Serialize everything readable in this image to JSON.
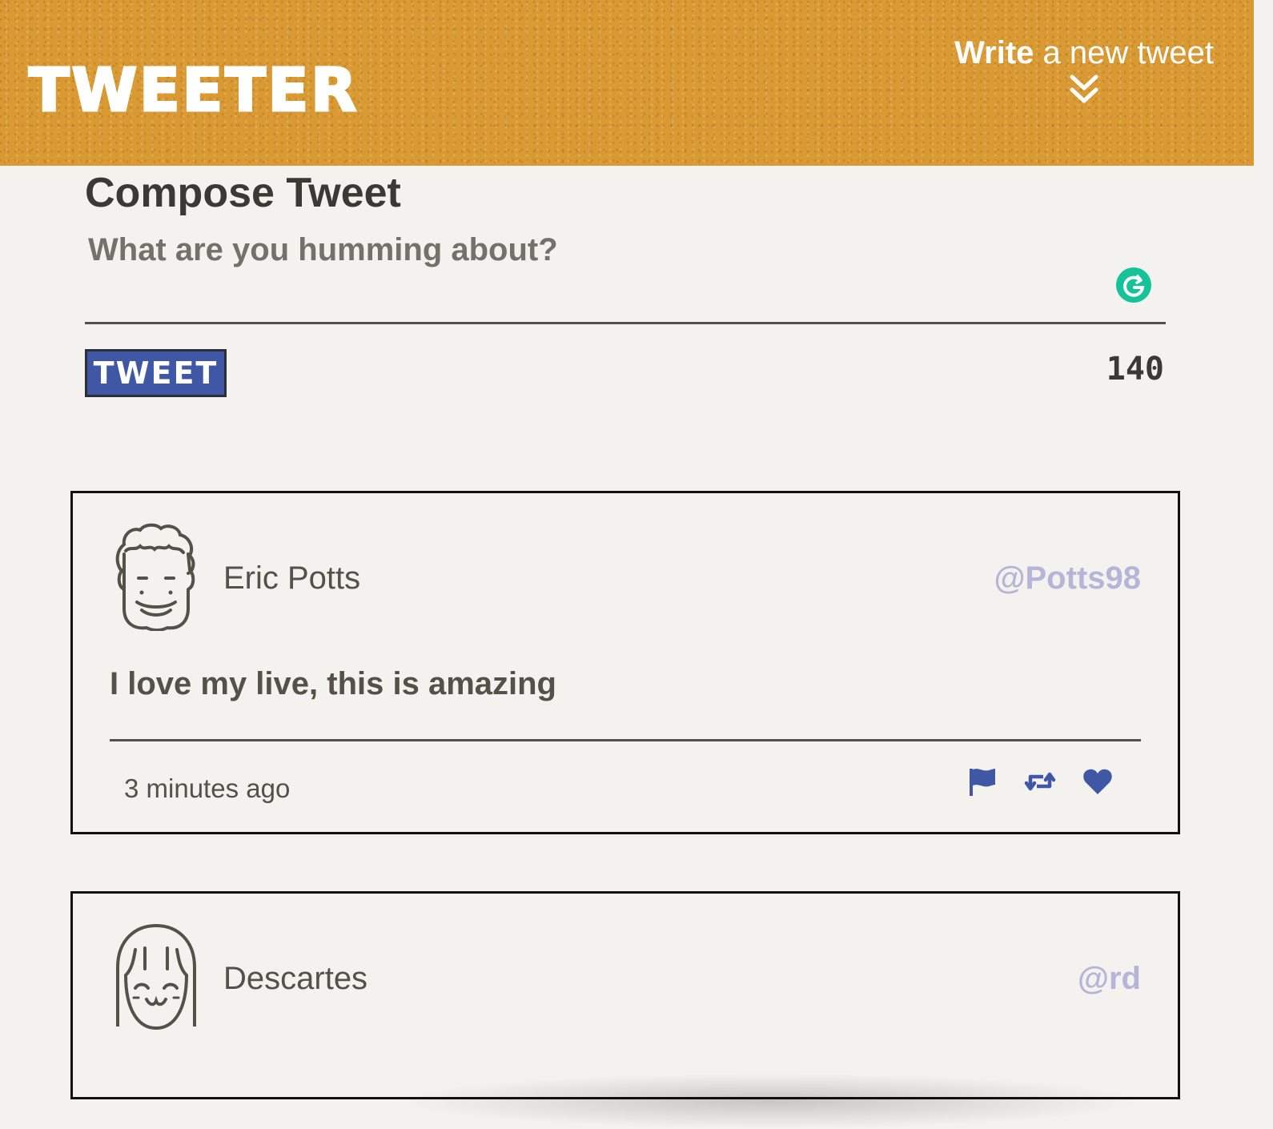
{
  "nav": {
    "logo": "TWEETER",
    "write_bold": "Write",
    "write_rest": " a new tweet",
    "toggle_icon": "double-chevron-down-icon"
  },
  "compose": {
    "title": "Compose Tweet",
    "placeholder": "What are you humming about?",
    "value": "",
    "button_label": "TWEET",
    "counter": "140"
  },
  "tweets": [
    {
      "name": "Eric Potts",
      "handle": "@Potts98",
      "text": "I love my live, this is amazing",
      "time": "3 minutes ago",
      "actions": [
        "flag-icon",
        "retweet-icon",
        "heart-icon"
      ]
    },
    {
      "name": "Descartes",
      "handle": "@rd"
    }
  ],
  "colors": {
    "nav_bg": "#d99a34",
    "accent": "#4057a5",
    "handle": "#b6b5d8",
    "text": "#545149",
    "grammarly": "#15c39a"
  }
}
